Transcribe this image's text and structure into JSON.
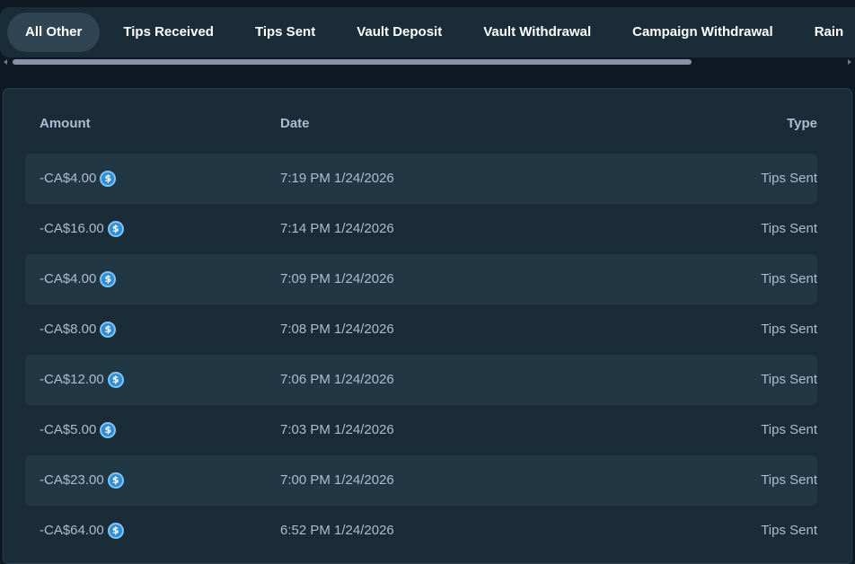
{
  "tabs": [
    {
      "label": "All Other",
      "active": true
    },
    {
      "label": "Tips Received",
      "active": false
    },
    {
      "label": "Tips Sent",
      "active": false
    },
    {
      "label": "Vault Deposit",
      "active": false
    },
    {
      "label": "Vault Withdrawal",
      "active": false
    },
    {
      "label": "Campaign Withdrawal",
      "active": false
    },
    {
      "label": "Rain",
      "active": false
    }
  ],
  "table": {
    "headers": {
      "amount": "Amount",
      "date": "Date",
      "type": "Type"
    },
    "rows": [
      {
        "amount": "-CA$4.00",
        "date": "7:19 PM 1/24/2026",
        "type": "Tips Sent",
        "icon": "usdc-coin-icon"
      },
      {
        "amount": "-CA$16.00",
        "date": "7:14 PM 1/24/2026",
        "type": "Tips Sent",
        "icon": "usdc-coin-icon"
      },
      {
        "amount": "-CA$4.00",
        "date": "7:09 PM 1/24/2026",
        "type": "Tips Sent",
        "icon": "usdc-coin-icon"
      },
      {
        "amount": "-CA$8.00",
        "date": "7:08 PM 1/24/2026",
        "type": "Tips Sent",
        "icon": "usdc-coin-icon"
      },
      {
        "amount": "-CA$12.00",
        "date": "7:06 PM 1/24/2026",
        "type": "Tips Sent",
        "icon": "usdc-coin-icon"
      },
      {
        "amount": "-CA$5.00",
        "date": "7:03 PM 1/24/2026",
        "type": "Tips Sent",
        "icon": "usdc-coin-icon"
      },
      {
        "amount": "-CA$23.00",
        "date": "7:00 PM 1/24/2026",
        "type": "Tips Sent",
        "icon": "usdc-coin-icon"
      },
      {
        "amount": "-CA$64.00",
        "date": "6:52 PM 1/24/2026",
        "type": "Tips Sent",
        "icon": "usdc-coin-icon"
      }
    ]
  },
  "colors": {
    "background": "#0f1923",
    "panel": "#1a2c38",
    "row_alt": "#213743",
    "active_tab": "#2f4553",
    "text_muted": "#b1bad3",
    "coin": "#2f8cd6"
  }
}
